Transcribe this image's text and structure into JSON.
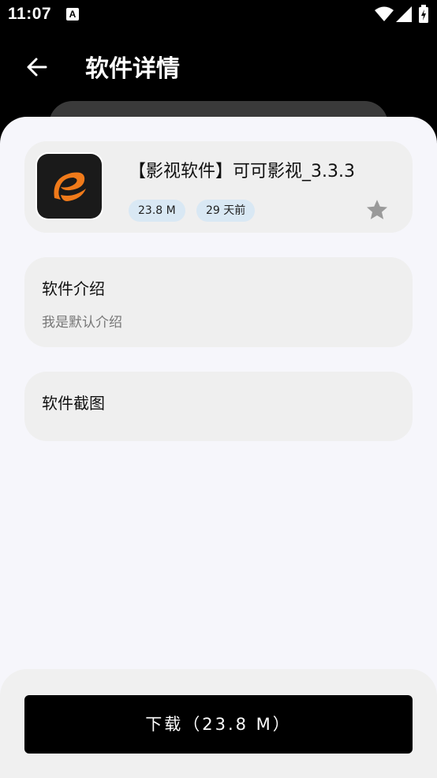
{
  "status_bar": {
    "time": "11:07",
    "notification_glyph": "A"
  },
  "header": {
    "title": "软件详情"
  },
  "app": {
    "name": "【影视软件】可可影视_3.3.3",
    "size": "23.8 M",
    "updated": "29 天前"
  },
  "intro": {
    "title": "软件介绍",
    "description": "我是默认介绍"
  },
  "screenshots": {
    "title": "软件截图"
  },
  "download": {
    "label": "下载（23.8 M）"
  },
  "colors": {
    "accent_orange": "#f07a1a",
    "chip_bg": "#d9e8f4",
    "star": "#9a9a9a"
  },
  "icons": [
    "back-arrow-icon",
    "wifi-icon",
    "signal-icon",
    "battery-icon",
    "star-icon",
    "app-logo-icon"
  ]
}
